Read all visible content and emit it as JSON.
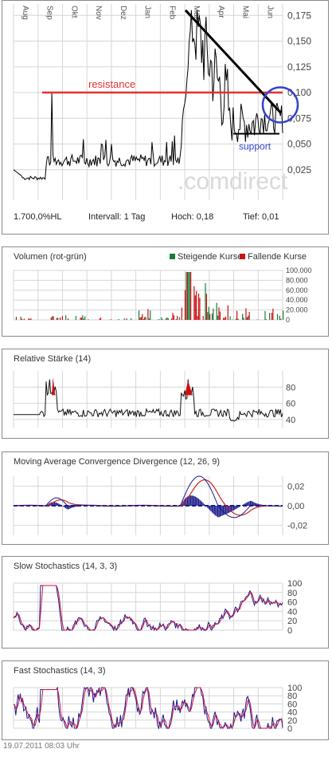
{
  "main": {
    "months": [
      "Aug",
      "Sep",
      "Okt",
      "Nov",
      "Dez",
      "Jan",
      "Feb",
      "Mär",
      "Apr",
      "Mai",
      "Jun"
    ],
    "yticks": [
      "0,175",
      "0,150",
      "0,125",
      "0,100",
      "0,075",
      "0,050",
      "0,025"
    ],
    "watermark": ".comdirect",
    "resistance_label": "resistance",
    "support_label": "support",
    "info": {
      "instrument": "1.700,0%HL",
      "interval": "Intervall: 1 Tag",
      "high": "Hoch:  0,18",
      "low": "Tief:   0,01"
    }
  },
  "volume": {
    "title": "Volumen (rot-grün)",
    "legend_up": "Steigende Kurse",
    "legend_down": "Fallende Kurse",
    "yticks": [
      "100.000",
      "80.000",
      "60.000",
      "40.000",
      "20.000",
      "0"
    ]
  },
  "rsi": {
    "title": "Relative Stärke (14)",
    "yticks": [
      "80",
      "60",
      "40"
    ]
  },
  "macd": {
    "title": "Moving Average Convergence Divergence (12, 26, 9)",
    "yticks": [
      "0,02",
      "0,00",
      "-0,02"
    ]
  },
  "slow": {
    "title": "Slow Stochastics (14, 3, 3)",
    "yticks": [
      "100",
      "80",
      "60",
      "40",
      "20",
      "0"
    ]
  },
  "fast": {
    "title": "Fast Stochastics (14, 3)",
    "yticks": [
      "100",
      "80",
      "60",
      "40",
      "20",
      "0"
    ]
  },
  "footer": "19.07.2011 08:03 Uhr",
  "colors": {
    "price": "#000000",
    "resistance": "#e03030",
    "support_text": "#3344cc",
    "circle": "#3344cc",
    "up": "#1a7a3a",
    "down": "#cc1111",
    "macd_signal": "#cc2222",
    "macd_line": "#1a1a8a",
    "stoch_k": "#1a1a8a",
    "stoch_d": "#cc1144",
    "grid": "#d6d6d6"
  },
  "chart_data": [
    {
      "type": "line",
      "name": "price",
      "x": [
        "Aug",
        "Aug",
        "Sep",
        "Sep",
        "Okt",
        "Nov",
        "Dez",
        "Jan",
        "Feb",
        "Feb",
        "Mär",
        "Mär",
        "Apr",
        "Apr",
        "Mai",
        "Mai",
        "Jun",
        "Jun",
        "Jul"
      ],
      "values": [
        0.025,
        0.015,
        0.027,
        0.1,
        0.03,
        0.025,
        0.028,
        0.024,
        0.026,
        0.095,
        0.18,
        0.14,
        0.12,
        0.095,
        0.06,
        0.085,
        0.062,
        0.09,
        0.08
      ],
      "ylim": [
        0,
        0.18
      ],
      "annotations": {
        "resistance": 0.1,
        "trendline": [
          [
            "Mär",
            0.18
          ],
          [
            "Jul",
            0.08
          ]
        ],
        "support": 0.06
      }
    },
    {
      "type": "bar",
      "name": "volume",
      "ylim": [
        0,
        100000
      ]
    },
    {
      "type": "line",
      "name": "rsi",
      "ylim": [
        30,
        100
      ]
    },
    {
      "type": "line",
      "name": "macd",
      "ylim": [
        -0.03,
        0.03
      ]
    },
    {
      "type": "line",
      "name": "slow-stochastics",
      "ylim": [
        0,
        100
      ]
    },
    {
      "type": "line",
      "name": "fast-stochastics",
      "ylim": [
        0,
        100
      ]
    }
  ]
}
